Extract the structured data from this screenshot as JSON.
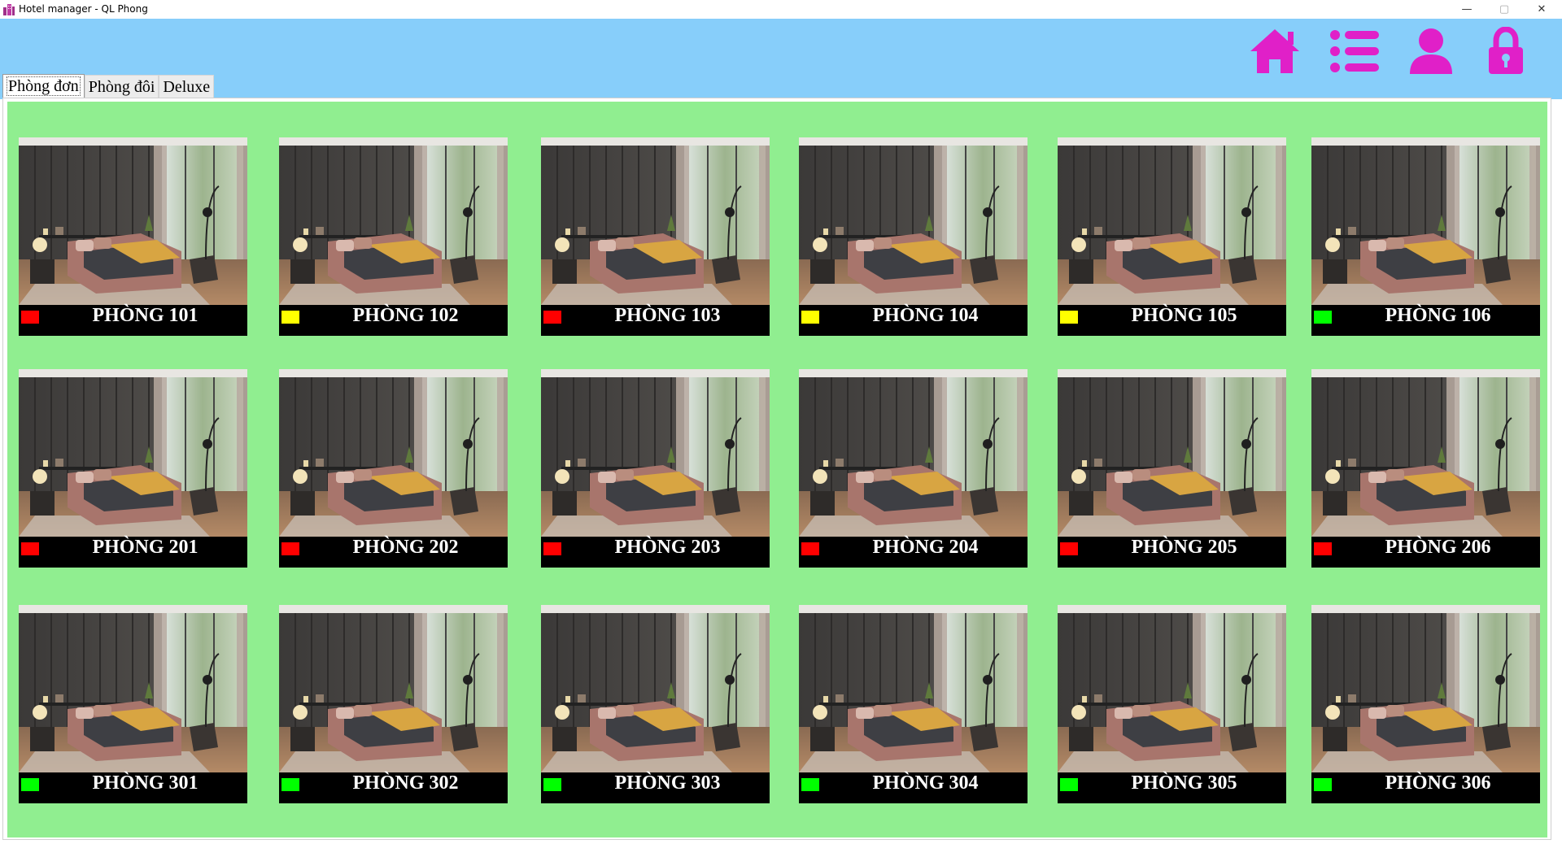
{
  "window": {
    "title": "Hotel manager - QL Phong",
    "minimize": "—",
    "maximize": "▢",
    "close": "✕"
  },
  "header": {
    "icon_color": "#e020c8",
    "background": "#87cefa",
    "icons": [
      "home-icon",
      "list-icon",
      "user-icon",
      "lock-icon"
    ]
  },
  "tabs": [
    {
      "label": "Phòng đơn",
      "active": true
    },
    {
      "label": "Phòng đôi",
      "active": false
    },
    {
      "label": "Deluxe",
      "active": false
    }
  ],
  "status_colors": {
    "occupied": "#ff0000",
    "reserved": "#ffff00",
    "available": "#00ff00"
  },
  "rooms": [
    {
      "name": "PHÒNG 101",
      "status": "occupied"
    },
    {
      "name": "PHÒNG 102",
      "status": "reserved"
    },
    {
      "name": "PHÒNG 103",
      "status": "occupied"
    },
    {
      "name": "PHÒNG 104",
      "status": "reserved"
    },
    {
      "name": "PHÒNG 105",
      "status": "reserved"
    },
    {
      "name": "PHÒNG 106",
      "status": "available"
    },
    {
      "name": "PHÒNG 201",
      "status": "occupied"
    },
    {
      "name": "PHÒNG 202",
      "status": "occupied"
    },
    {
      "name": "PHÒNG 203",
      "status": "occupied"
    },
    {
      "name": "PHÒNG 204",
      "status": "occupied"
    },
    {
      "name": "PHÒNG 205",
      "status": "occupied"
    },
    {
      "name": "PHÒNG 206",
      "status": "occupied"
    },
    {
      "name": "PHÒNG 301",
      "status": "available"
    },
    {
      "name": "PHÒNG 302",
      "status": "available"
    },
    {
      "name": "PHÒNG 303",
      "status": "available"
    },
    {
      "name": "PHÒNG 304",
      "status": "available"
    },
    {
      "name": "PHÒNG 305",
      "status": "available"
    },
    {
      "name": "PHÒNG 306",
      "status": "available"
    }
  ]
}
